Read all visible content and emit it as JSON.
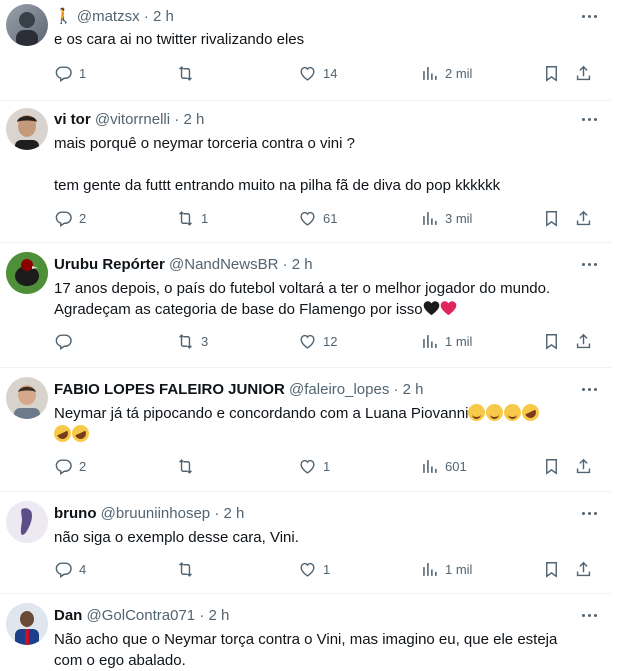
{
  "tweets": [
    {
      "name": "",
      "prefix": "🚶",
      "handle": "@matzsx",
      "dot": "·",
      "time": "2 h",
      "text": "e os cara ai no twitter rivalizando eles",
      "replies": "1",
      "retweets": "",
      "likes": "14",
      "views": "2 mil"
    },
    {
      "name": "vi tor",
      "handle": "@vitorrnelli",
      "dot": "·",
      "time": "2 h",
      "text": "mais porquê o neymar torceria contra o vini ?\n\ntem gente da futtt entrando muito na pilha fã de diva do pop kkkkkk",
      "replies": "2",
      "retweets": "1",
      "likes": "61",
      "views": "3 mil"
    },
    {
      "name": "Urubu Repórter",
      "handle": "@NandNewsBR",
      "dot": "·",
      "time": "2 h",
      "text": "17 anos depois, o país do futebol voltará a ter o melhor jogador do mundo. Agradeçam as categoria de base do Flamengo por isso",
      "replies": "",
      "retweets": "3",
      "likes": "12",
      "views": "1 mil"
    },
    {
      "name": "FABIO LOPES FALEIRO JUNIOR",
      "handle": "@faleiro_lopes",
      "dot": "·",
      "time": "2 h",
      "text": "Neymar já tá pipocando e concordando com a Luana Piovanni",
      "replies": "2",
      "retweets": "",
      "likes": "1",
      "views": "601"
    },
    {
      "name": "bruno",
      "handle": "@bruuniinhosep",
      "dot": "·",
      "time": "2 h",
      "text": "não siga o exemplo desse cara, Vini.",
      "replies": "4",
      "retweets": "",
      "likes": "1",
      "views": "1 mil"
    },
    {
      "name": "Dan",
      "handle": "@GolContra071",
      "dot": "·",
      "time": "2 h",
      "text": "Não acho que o Neymar torça contra o Vini, mas imagino eu, que ele esteja com o ego abalado.",
      "replies": "",
      "retweets": "",
      "likes": "",
      "views": ""
    }
  ],
  "colors": {
    "text": "#0f1419",
    "muted": "#536471",
    "divider": "#eff3f4"
  },
  "icons": [
    "reply-icon",
    "retweet-icon",
    "like-icon",
    "views-icon",
    "bookmark-icon",
    "share-icon",
    "more-icon"
  ]
}
